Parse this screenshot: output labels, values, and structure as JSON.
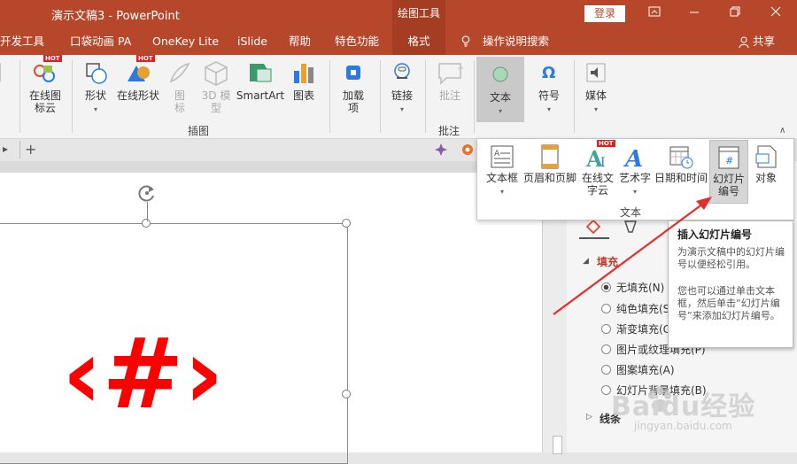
{
  "titlebar": {
    "title": "演示文稿3 - PowerPoint",
    "context_tab": "绘图工具",
    "login": "登录"
  },
  "menu": {
    "items": [
      "开发工具",
      "口袋动画 PA",
      "OneKey Lite",
      "iSlide",
      "帮助",
      "特色功能",
      "格式"
    ],
    "search": "操作说明搜索",
    "share": "共享"
  },
  "ribbon": {
    "online_icon_cloud": "在线图标云",
    "shapes": "形状",
    "online_shapes": "在线形状",
    "icons": "图标",
    "model3d": "3D 模型",
    "smartart": "SmartArt",
    "chart": "图表",
    "group_illustrations": "插图",
    "addins": "加载项",
    "link": "链接",
    "comment": "批注",
    "group_comments": "批注",
    "text": "文本",
    "symbol": "符号",
    "media": "媒体",
    "hot": "HOT"
  },
  "dropdown": {
    "textbox": "文本框",
    "header_footer": "页眉和页脚",
    "online_text_cloud": "在线文字云",
    "wordart": "艺术字",
    "datetime": "日期和时间",
    "slide_number": "幻灯片编号",
    "object": "对象",
    "group_label": "文本"
  },
  "tooltip": {
    "title": "插入幻灯片编号",
    "p1": "为演示文稿中的幻灯片编号以便经松引用。",
    "p2": "您也可以通过单击文本框，然后单击“幻灯片编号”来添加幻灯片编号。"
  },
  "pane": {
    "fill_header": "填充",
    "options": [
      "无填充(N)",
      "纯色填充(S)",
      "渐变填充(G)",
      "图片或纹理填充(P)",
      "图案填充(A)",
      "幻灯片背景填充(B)"
    ],
    "line_header": "线条"
  },
  "slide": {
    "symbol": "‹#›"
  },
  "watermark": {
    "brand": "Baidu经验",
    "url": "jingyan.baidu.com"
  },
  "colors": {
    "accent": "#b7472a",
    "symbol": "#ff0000",
    "arrow": "#e0302a"
  }
}
